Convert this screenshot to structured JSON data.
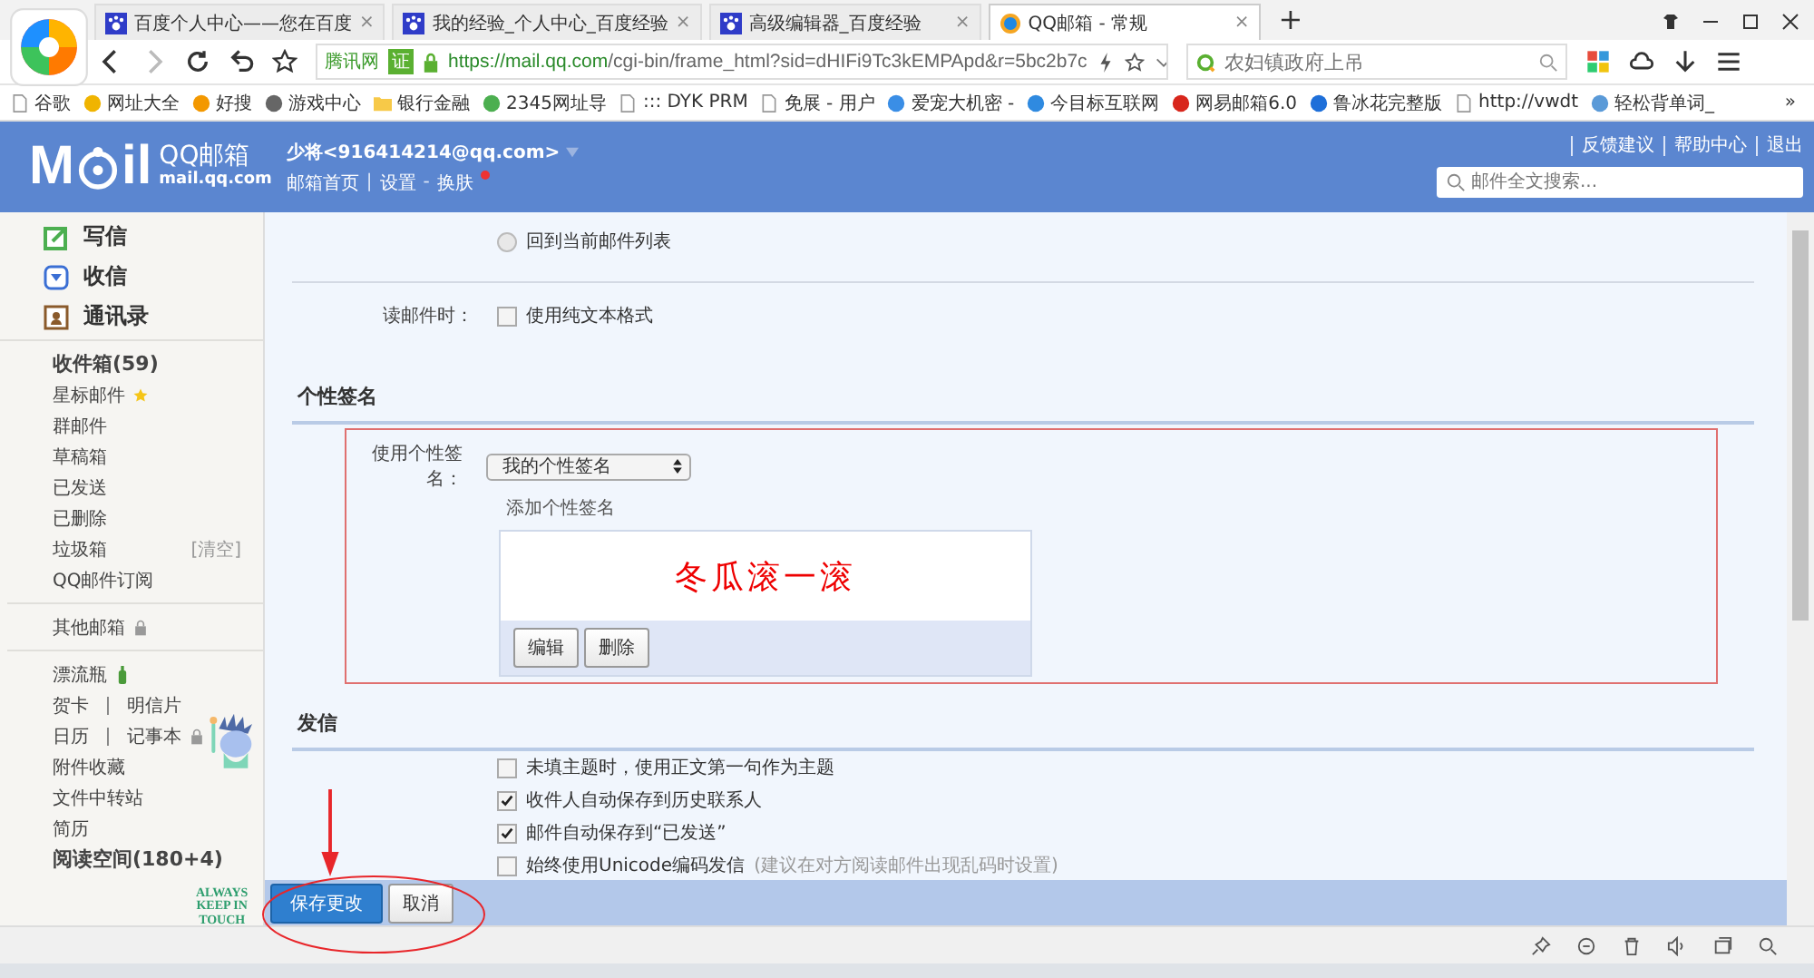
{
  "browser": {
    "tabs": [
      {
        "title": "百度个人中心——您在百度",
        "selected": false,
        "close": "×"
      },
      {
        "title": "我的经验_个人中心_百度经验",
        "selected": false,
        "close": "×"
      },
      {
        "title": "高级编辑器_百度经验",
        "selected": false,
        "close": "×"
      },
      {
        "title": "QQ邮箱 - 常规",
        "selected": true,
        "close": "×"
      }
    ],
    "new_tab": "+",
    "site_label": "腾讯网",
    "cert_badge": "证",
    "url_host": "https://mail.qq.com",
    "url_path": "/cgi-bin/frame_html?sid=dHIFi9Tc3kEMPApd&r=5bc2b7c",
    "search_placeholder": "农妇镇政府上吊",
    "bookmarks": [
      {
        "label": "谷歌",
        "kind": "page"
      },
      {
        "label": "网址大全",
        "kind": "site",
        "color": "#f0b400"
      },
      {
        "label": "好搜",
        "kind": "site",
        "color": "#f39800"
      },
      {
        "label": "游戏中心",
        "kind": "site",
        "color": "#666666"
      },
      {
        "label": "银行金融",
        "kind": "folder"
      },
      {
        "label": "2345网址导",
        "kind": "site",
        "color": "#4caf50"
      },
      {
        "label": "::: DYK PRM",
        "kind": "page"
      },
      {
        "label": "免展 - 用户",
        "kind": "page"
      },
      {
        "label": "爱宠大机密 -",
        "kind": "site",
        "color": "#3a8ee6"
      },
      {
        "label": "今目标互联网",
        "kind": "site",
        "color": "#2f8ae0"
      },
      {
        "label": "网易邮箱6.0",
        "kind": "site",
        "color": "#d8261c"
      },
      {
        "label": "鲁冰花完整版",
        "kind": "site",
        "color": "#1e6fd9"
      },
      {
        "label": "http://vwdt",
        "kind": "page"
      },
      {
        "label": "轻松背单词_",
        "kind": "site",
        "color": "#5a9ad8"
      }
    ],
    "more": "»"
  },
  "mail_header": {
    "logo_word": "M",
    "logo_rest": "il",
    "brand": "QQ邮箱",
    "brand_domain": "mail.qq.com",
    "user": "少将<916414214@qq.com>",
    "nav": [
      "邮箱首页",
      "设置",
      "换肤"
    ],
    "nav_separators": [
      "|",
      "-"
    ],
    "links": [
      "反馈建议",
      "帮助中心",
      "退出"
    ],
    "search_placeholder": "邮件全文搜索..."
  },
  "sidebar": {
    "actions": [
      {
        "label": "写信",
        "kind": "write"
      },
      {
        "label": "收信",
        "kind": "inbox"
      },
      {
        "label": "通讯录",
        "kind": "contacts"
      }
    ],
    "folders": [
      {
        "label": "收件箱(59)",
        "bold": true,
        "kind": "plain"
      },
      {
        "label": "星标邮件",
        "bold": false,
        "kind": "star"
      },
      {
        "label": "群邮件",
        "bold": false,
        "kind": "plain"
      },
      {
        "label": "草稿箱",
        "bold": false,
        "kind": "plain"
      },
      {
        "label": "已发送",
        "bold": false,
        "kind": "plain"
      },
      {
        "label": "已删除",
        "bold": false,
        "kind": "plain"
      },
      {
        "label": "垃圾箱",
        "bold": false,
        "kind": "plain",
        "action": "[清空]"
      },
      {
        "label": "QQ邮件订阅",
        "bold": false,
        "kind": "plain"
      }
    ],
    "other": [
      {
        "label": "其他邮箱",
        "bold": false,
        "kind": "lock"
      }
    ],
    "apps": [
      {
        "parts": [
          "漂流瓶"
        ],
        "bold": false,
        "kind": "bottle"
      },
      {
        "parts": [
          "贺卡",
          "明信片"
        ],
        "bold": false,
        "kind": "plain"
      },
      {
        "parts": [
          "日历",
          "记事本"
        ],
        "bold": false,
        "kind": "lock"
      },
      {
        "parts": [
          "附件收藏"
        ],
        "bold": false,
        "kind": "plain"
      },
      {
        "parts": [
          "文件中转站"
        ],
        "bold": false,
        "kind": "plain"
      },
      {
        "parts": [
          "简历"
        ],
        "bold": false,
        "kind": "plain"
      },
      {
        "parts": [
          "阅读空间(180+4)"
        ],
        "bold": true,
        "kind": "plain"
      }
    ],
    "mascot_text": [
      "ALWAYS",
      "KEEP IN",
      "TOUCH"
    ]
  },
  "settings": {
    "return_option": {
      "label": "回到当前邮件列表",
      "selected": false
    },
    "read_label": "读邮件时：",
    "plain_text": {
      "label": "使用纯文本格式",
      "checked": false
    },
    "signature": {
      "heading": "个性签名",
      "label": "使用个性签名：",
      "select": "我的个性签名",
      "add_link": "添加个性签名",
      "preview": "冬瓜滚一滚",
      "buttons": [
        "编辑",
        "删除"
      ]
    },
    "send": {
      "heading": "发信",
      "options": [
        {
          "label": "未填主题时，使用正文第一句作为主题",
          "checked": false
        },
        {
          "label": "收件人自动保存到历史联系人",
          "checked": true
        },
        {
          "label": "邮件自动保存到“已发送”",
          "checked": true
        },
        {
          "label": "始终使用Unicode编码发信",
          "hint": "(建议在对方阅读邮件出现乱码时设置)",
          "checked": false
        }
      ]
    },
    "save": "保存更改",
    "cancel": "取消"
  }
}
